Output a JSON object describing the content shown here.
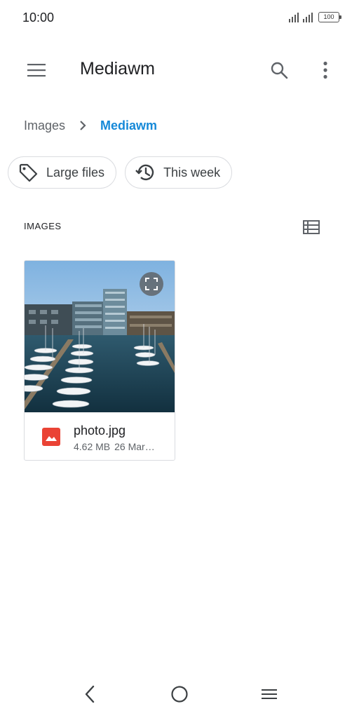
{
  "status_bar": {
    "time": "10:00",
    "battery": "100"
  },
  "app_bar": {
    "title": "Mediawm",
    "menu_icon": "hamburger-menu-icon",
    "search_icon": "search-icon",
    "more_icon": "more-vert-icon"
  },
  "breadcrumb": {
    "root": "Images",
    "current": "Mediawm",
    "current_color": "#1689d8"
  },
  "chips": [
    {
      "label": "Large files",
      "icon": "tag-icon"
    },
    {
      "label": "This week",
      "icon": "history-icon"
    }
  ],
  "section": {
    "title": "IMAGES",
    "view_icon": "list-view-icon"
  },
  "files": [
    {
      "name": "photo.jpg",
      "size": "4.62 MB",
      "date": "26 Mar…",
      "type_icon": "image-file-icon",
      "type_color": "#ea4335"
    }
  ],
  "nav_bar": {
    "back_icon": "back-icon",
    "home_icon": "home-icon",
    "recents_icon": "menu-icon"
  }
}
